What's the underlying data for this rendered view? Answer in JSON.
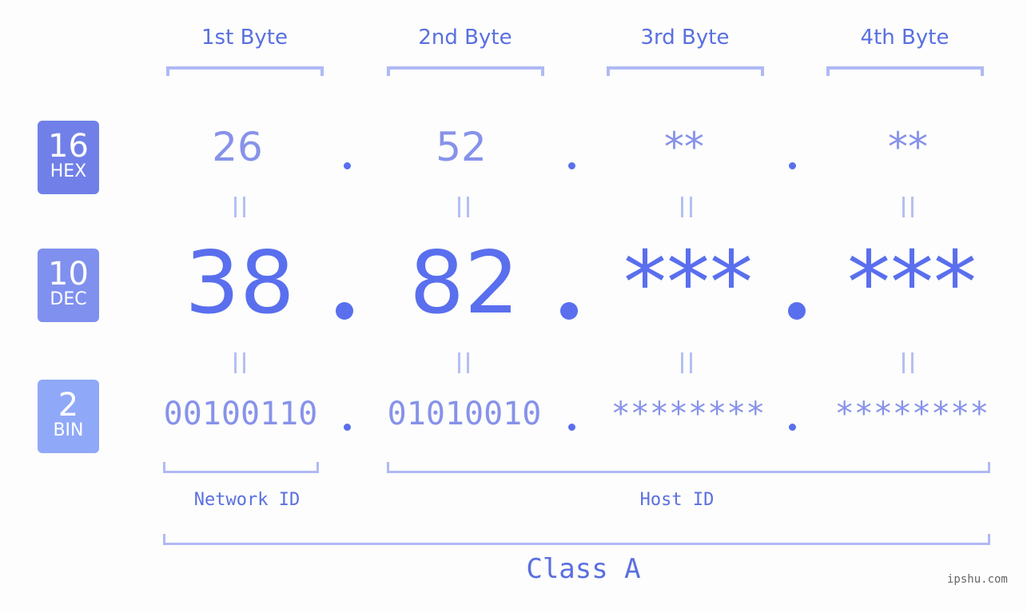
{
  "byte_headers": [
    "1st Byte",
    "2nd Byte",
    "3rd Byte",
    "4th Byte"
  ],
  "badges": {
    "hex": {
      "number": "16",
      "label": "HEX",
      "color": "#7080e8"
    },
    "dec": {
      "number": "10",
      "label": "DEC",
      "color": "#8090ee"
    },
    "bin": {
      "number": "2",
      "label": "BIN",
      "color": "#90a8f8"
    }
  },
  "hex_values": [
    "26",
    "52",
    "**",
    "**"
  ],
  "dec_values": [
    "38",
    "82",
    "***",
    "***"
  ],
  "bin_values": [
    "00100110",
    "01010010",
    "********",
    "********"
  ],
  "equals_sign": "=",
  "network_id_label": "Network ID",
  "host_id_label": "Host ID",
  "class_label": "Class A",
  "watermark": "ipshu.com",
  "colors": {
    "accent": "#5a6fee",
    "light_value": "#8792ea",
    "bracket": "#b0b9f5"
  }
}
